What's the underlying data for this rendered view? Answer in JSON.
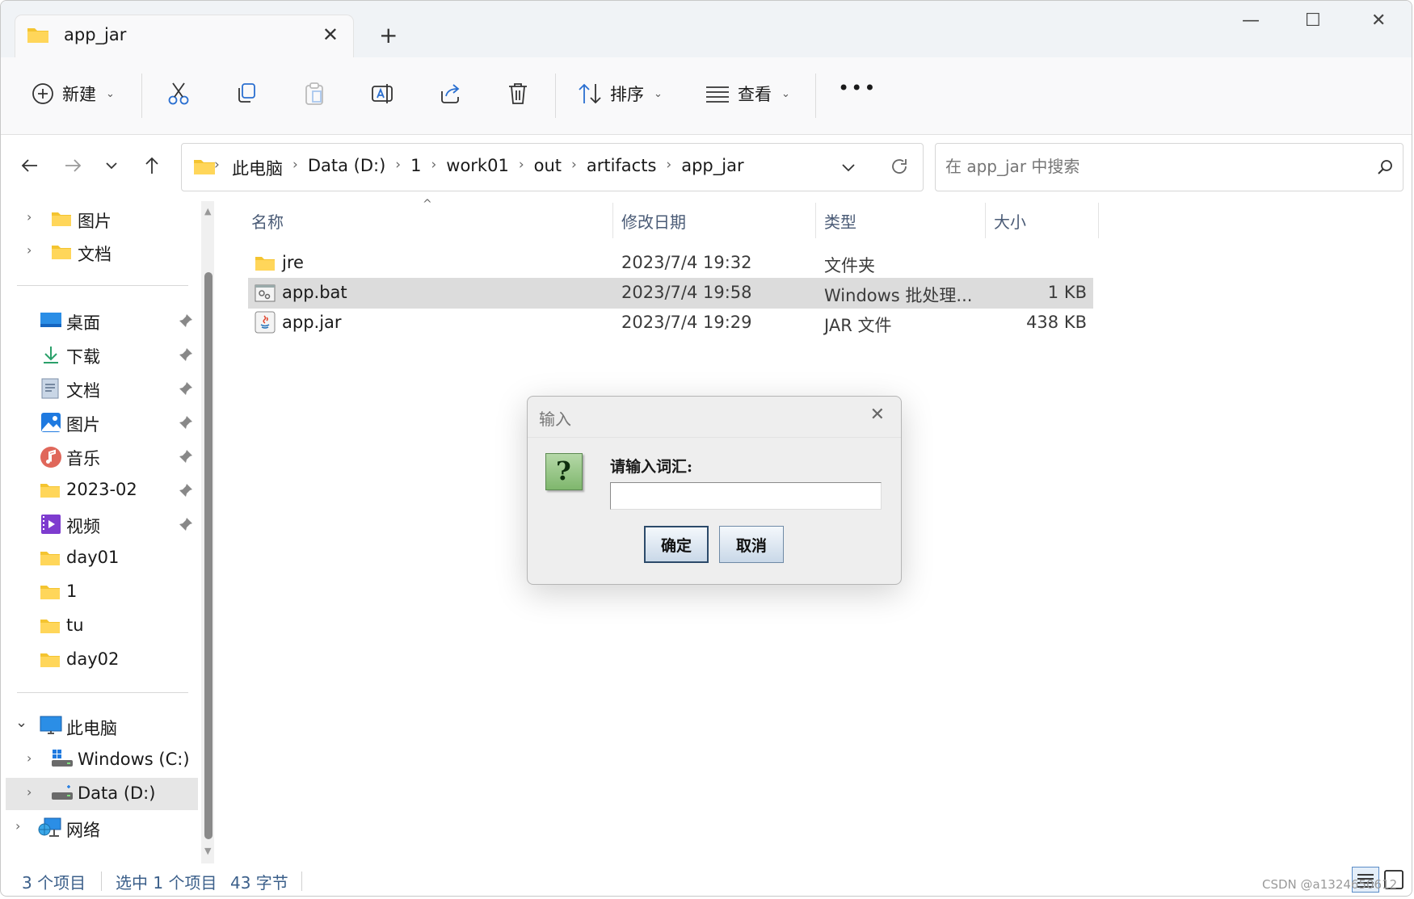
{
  "window": {
    "tab_title": "app_jar",
    "new_tab": "+",
    "min": "—",
    "max": "☐",
    "close": "✕"
  },
  "toolbar": {
    "new_label": "新建",
    "sort_label": "排序",
    "view_label": "查看",
    "more": "•••"
  },
  "breadcrumb": [
    "此电脑",
    "Data (D:)",
    "1",
    "work01",
    "out",
    "artifacts",
    "app_jar"
  ],
  "search": {
    "placeholder": "在 app_jar 中搜索"
  },
  "sidebar": {
    "top": [
      {
        "label": "图片"
      },
      {
        "label": "文档"
      }
    ],
    "quick": [
      {
        "label": "桌面",
        "icon": "desktop-icon",
        "pinned": true
      },
      {
        "label": "下载",
        "icon": "download-icon",
        "pinned": true
      },
      {
        "label": "文档",
        "icon": "document-icon",
        "pinned": true
      },
      {
        "label": "图片",
        "icon": "picture-icon",
        "pinned": true
      },
      {
        "label": "音乐",
        "icon": "music-icon",
        "pinned": true
      },
      {
        "label": "2023-02",
        "icon": "folder-icon",
        "pinned": true
      },
      {
        "label": "视频",
        "icon": "video-icon",
        "pinned": true
      },
      {
        "label": "day01",
        "icon": "folder-icon",
        "pinned": false
      },
      {
        "label": "1",
        "icon": "folder-icon",
        "pinned": false
      },
      {
        "label": "tu",
        "icon": "folder-icon",
        "pinned": false
      },
      {
        "label": "day02",
        "icon": "folder-icon",
        "pinned": false
      }
    ],
    "this_pc": "此电脑",
    "drives": [
      {
        "label": "Windows (C:)"
      },
      {
        "label": "Data (D:)"
      }
    ],
    "network": "网络"
  },
  "columns": {
    "name": "名称",
    "modified": "修改日期",
    "type": "类型",
    "size": "大小"
  },
  "files": [
    {
      "name": "jre",
      "modified": "2023/7/4 19:32",
      "type": "文件夹",
      "size": "",
      "icon": "folder-icon"
    },
    {
      "name": "app.bat",
      "modified": "2023/7/4 19:58",
      "type": "Windows 批处理...",
      "size": "1 KB",
      "icon": "batch-file-icon"
    },
    {
      "name": "app.jar",
      "modified": "2023/7/4 19:29",
      "type": "JAR 文件",
      "size": "438 KB",
      "icon": "jar-file-icon"
    }
  ],
  "status": {
    "count": "3 个项目",
    "selected": "选中 1 个项目",
    "size": "43 字节"
  },
  "dialog": {
    "title": "输入",
    "prompt": "请输入词汇:",
    "input_value": "",
    "ok": "确定",
    "cancel": "取消",
    "close": "✕",
    "icon_glyph": "?"
  },
  "watermark": "CSDN @a1324650612"
}
